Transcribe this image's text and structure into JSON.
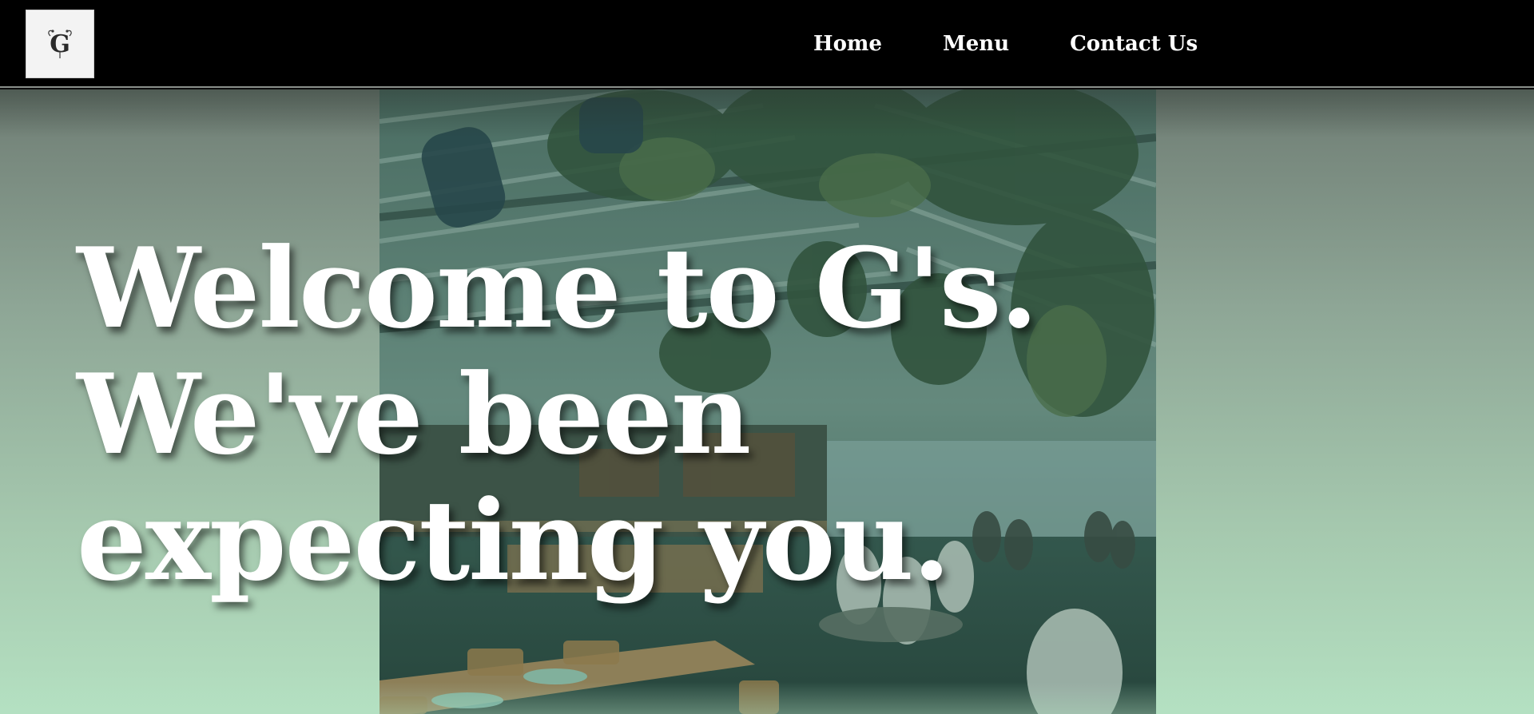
{
  "nav": {
    "logo": {
      "letter": "G",
      "icon": "floral-g-monogram-icon"
    },
    "links": [
      "Home",
      "Menu",
      "Contact Us"
    ]
  },
  "hero": {
    "headline_lines": [
      "Welcome to G's.",
      "We've been",
      "expecting you."
    ],
    "image": "greenhouse-restaurant-interior"
  },
  "colors": {
    "nav_bg": "#000000",
    "hero_gradient_top": "#6f7d74",
    "hero_gradient_bottom": "#b4e0c1",
    "headline": "#ffffff"
  }
}
